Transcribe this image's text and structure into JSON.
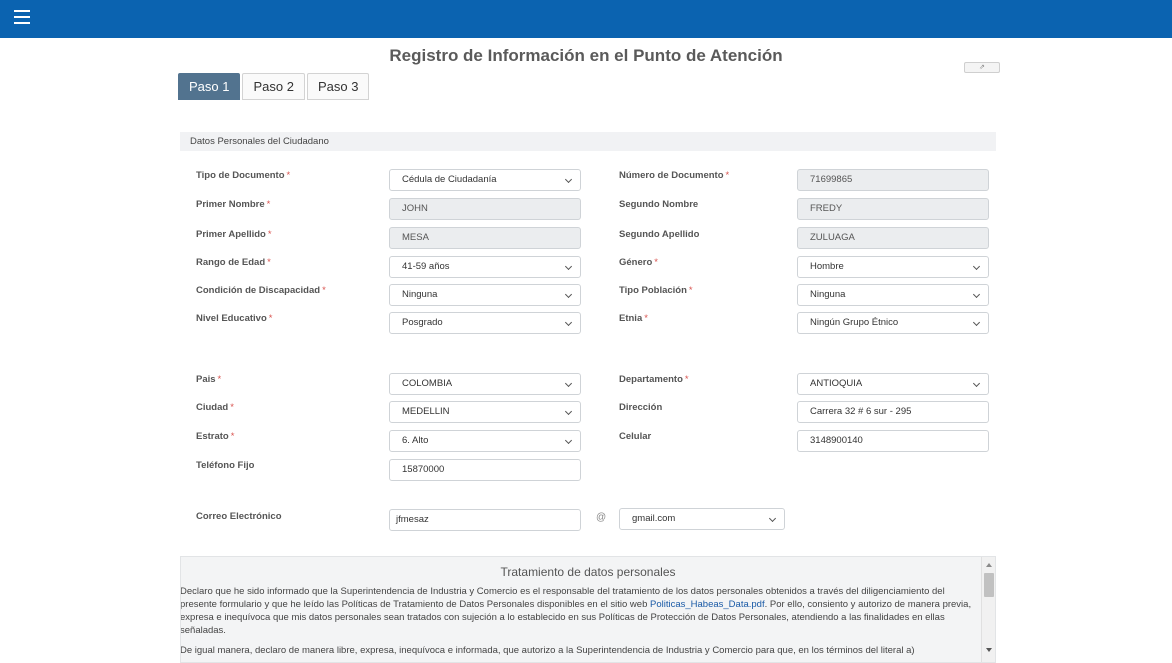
{
  "page_title": "Registro de Información en el Punto de Atención",
  "tabs": [
    "Paso 1",
    "Paso 2",
    "Paso 3"
  ],
  "section_title": "Datos Personales del Ciudadano",
  "form": {
    "tipo_documento": {
      "label": "Tipo de Documento",
      "value": "Cédula de Ciudadanía"
    },
    "numero_documento": {
      "label": "Número de Documento",
      "value": "71699865"
    },
    "primer_nombre": {
      "label": "Primer Nombre",
      "value": "JOHN"
    },
    "segundo_nombre": {
      "label": "Segundo Nombre",
      "value": "FREDY"
    },
    "primer_apellido": {
      "label": "Primer Apellido",
      "value": "MESA"
    },
    "segundo_apellido": {
      "label": "Segundo Apellido",
      "value": "ZULUAGA"
    },
    "rango_edad": {
      "label": "Rango de Edad",
      "value": "41-59 años"
    },
    "genero": {
      "label": "Género",
      "value": "Hombre"
    },
    "discapacidad": {
      "label": "Condición de Discapacidad",
      "value": "Ninguna"
    },
    "tipo_poblacion": {
      "label": "Tipo Población",
      "value": "Ninguna"
    },
    "nivel_educativo": {
      "label": "Nivel Educativo",
      "value": "Posgrado"
    },
    "etnia": {
      "label": "Etnia",
      "value": "Ningún Grupo Étnico"
    },
    "pais": {
      "label": "Pais",
      "value": "COLOMBIA"
    },
    "departamento": {
      "label": "Departamento",
      "value": "ANTIOQUIA"
    },
    "ciudad": {
      "label": "Ciudad",
      "value": "MEDELLIN"
    },
    "direccion": {
      "label": "Dirección",
      "value": "Carrera 32 # 6 sur - 295"
    },
    "estrato": {
      "label": "Estrato",
      "value": "6. Alto"
    },
    "celular": {
      "label": "Celular",
      "value": "3148900140"
    },
    "telefono_fijo": {
      "label": "Teléfono Fijo",
      "value": "15870000"
    },
    "correo": {
      "label": "Correo Electrónico",
      "user": "jfmesaz",
      "at": "@",
      "domain": "gmail.com"
    }
  },
  "required_mark": "*",
  "terms": {
    "title": "Tratamiento de datos personales",
    "p1_before": "Declaro que he sido informado que la Superintendencia de Industria y Comercio es el responsable del tratamiento de los datos personales obtenidos a través del diligenciamiento del presente formulario y que he leído las Políticas de Tratamiento de Datos Personales disponibles en el sitio web ",
    "p1_link": "Politicas_Habeas_Data.pdf",
    "p1_after": ". Por ello, consiento y autorizo de manera previa, expresa e inequívoca que mis datos personales sean tratados con sujeción a lo establecido en sus Políticas de Protección de Datos Personales, atendiendo a las finalidades en ellas señaladas.",
    "p2": "De igual manera, declaro de manera libre, expresa, inequívoca e informada, que autorizo a la Superintendencia de Industria y Comercio para que, en los términos del literal a)"
  },
  "icons": {
    "menu": "hamburger-icon",
    "external": "external-link-icon",
    "dropdown": "chevron-down-icon"
  },
  "colors": {
    "topbar": "#0b63b0",
    "active_tab": "#52738f",
    "required": "#d9534f",
    "link": "#1a5aa6"
  }
}
